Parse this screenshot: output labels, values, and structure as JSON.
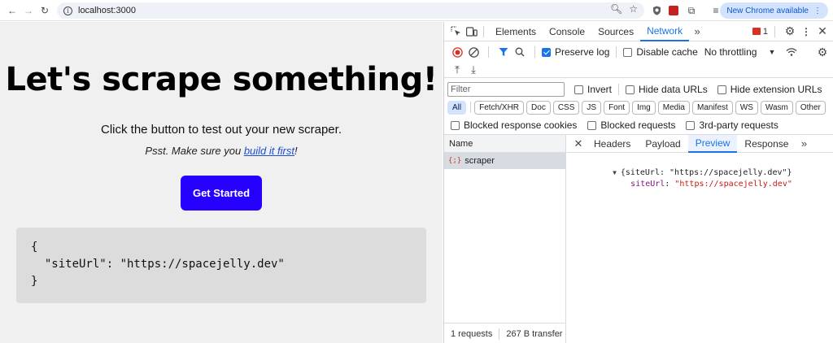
{
  "browser": {
    "url": "localhost:3000",
    "update_label": "New Chrome available"
  },
  "page": {
    "heading": "Let's scrape something!",
    "lead": "Click the button to test out your new scraper.",
    "tip_prefix": "Psst. Make sure you ",
    "tip_link": "build it first",
    "tip_suffix": "!",
    "button": "Get Started",
    "code": "{\n  \"siteUrl\": \"https://spacejelly.dev\"\n}"
  },
  "devtools": {
    "tabs": [
      "Elements",
      "Console",
      "Sources",
      "Network"
    ],
    "active_tab": "Network",
    "issues_count": "1",
    "toolbar": {
      "preserve_log": "Preserve log",
      "disable_cache": "Disable cache",
      "throttling": "No throttling"
    },
    "filter": {
      "placeholder": "Filter",
      "invert": "Invert",
      "hide_data_urls": "Hide data URLs",
      "hide_extension_urls": "Hide extension URLs"
    },
    "type_chips": [
      "All",
      "Fetch/XHR",
      "Doc",
      "CSS",
      "JS",
      "Font",
      "Img",
      "Media",
      "Manifest",
      "WS",
      "Wasm",
      "Other"
    ],
    "blocked": {
      "cookies": "Blocked response cookies",
      "requests": "Blocked requests",
      "third_party": "3rd-party requests"
    },
    "name_header": "Name",
    "request_name": "scraper",
    "footer": {
      "requests": "1 requests",
      "transferred": "267 B transfer"
    },
    "detail_tabs": [
      "Headers",
      "Payload",
      "Preview",
      "Response"
    ],
    "active_detail_tab": "Preview",
    "preview": {
      "summary": "{siteUrl: \"https://spacejelly.dev\"}",
      "key": "siteUrl",
      "value": "\"https://spacejelly.dev\""
    }
  },
  "colors": {
    "cta": "#2600ff",
    "accent": "#1a73e8"
  }
}
